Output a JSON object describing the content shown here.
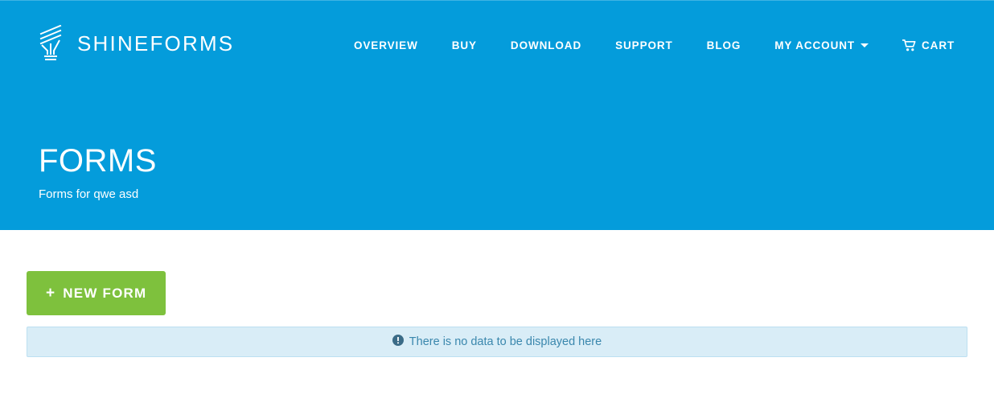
{
  "colors": {
    "brand_blue": "#049cdb",
    "button_green": "#7ec13d",
    "alert_bg": "#d9edf7",
    "alert_border": "#bcdff1",
    "alert_text": "#3a87ad",
    "white": "#ffffff"
  },
  "header": {
    "brand": {
      "name": "SHINEFORMS",
      "icon": "lightbulb-icon"
    },
    "nav": [
      {
        "label": "OVERVIEW",
        "name": "nav-item-overview",
        "icon": null,
        "caret": false
      },
      {
        "label": "BUY",
        "name": "nav-item-buy",
        "icon": null,
        "caret": false
      },
      {
        "label": "DOWNLOAD",
        "name": "nav-item-download",
        "icon": null,
        "caret": false
      },
      {
        "label": "SUPPORT",
        "name": "nav-item-support",
        "icon": null,
        "caret": false
      },
      {
        "label": "BLOG",
        "name": "nav-item-blog",
        "icon": null,
        "caret": false
      },
      {
        "label": "MY ACCOUNT",
        "name": "nav-item-my-account",
        "icon": null,
        "caret": true
      },
      {
        "label": "CART",
        "name": "nav-item-cart",
        "icon": "shopping-cart-icon",
        "caret": false
      }
    ]
  },
  "hero": {
    "title": "FORMS",
    "subtitle": "Forms for qwe asd"
  },
  "main": {
    "new_form_button": {
      "label": "NEW FORM",
      "plus": "+"
    },
    "alert": {
      "icon": "exclamation-circle-icon",
      "message": "There is no data to be displayed here"
    }
  }
}
